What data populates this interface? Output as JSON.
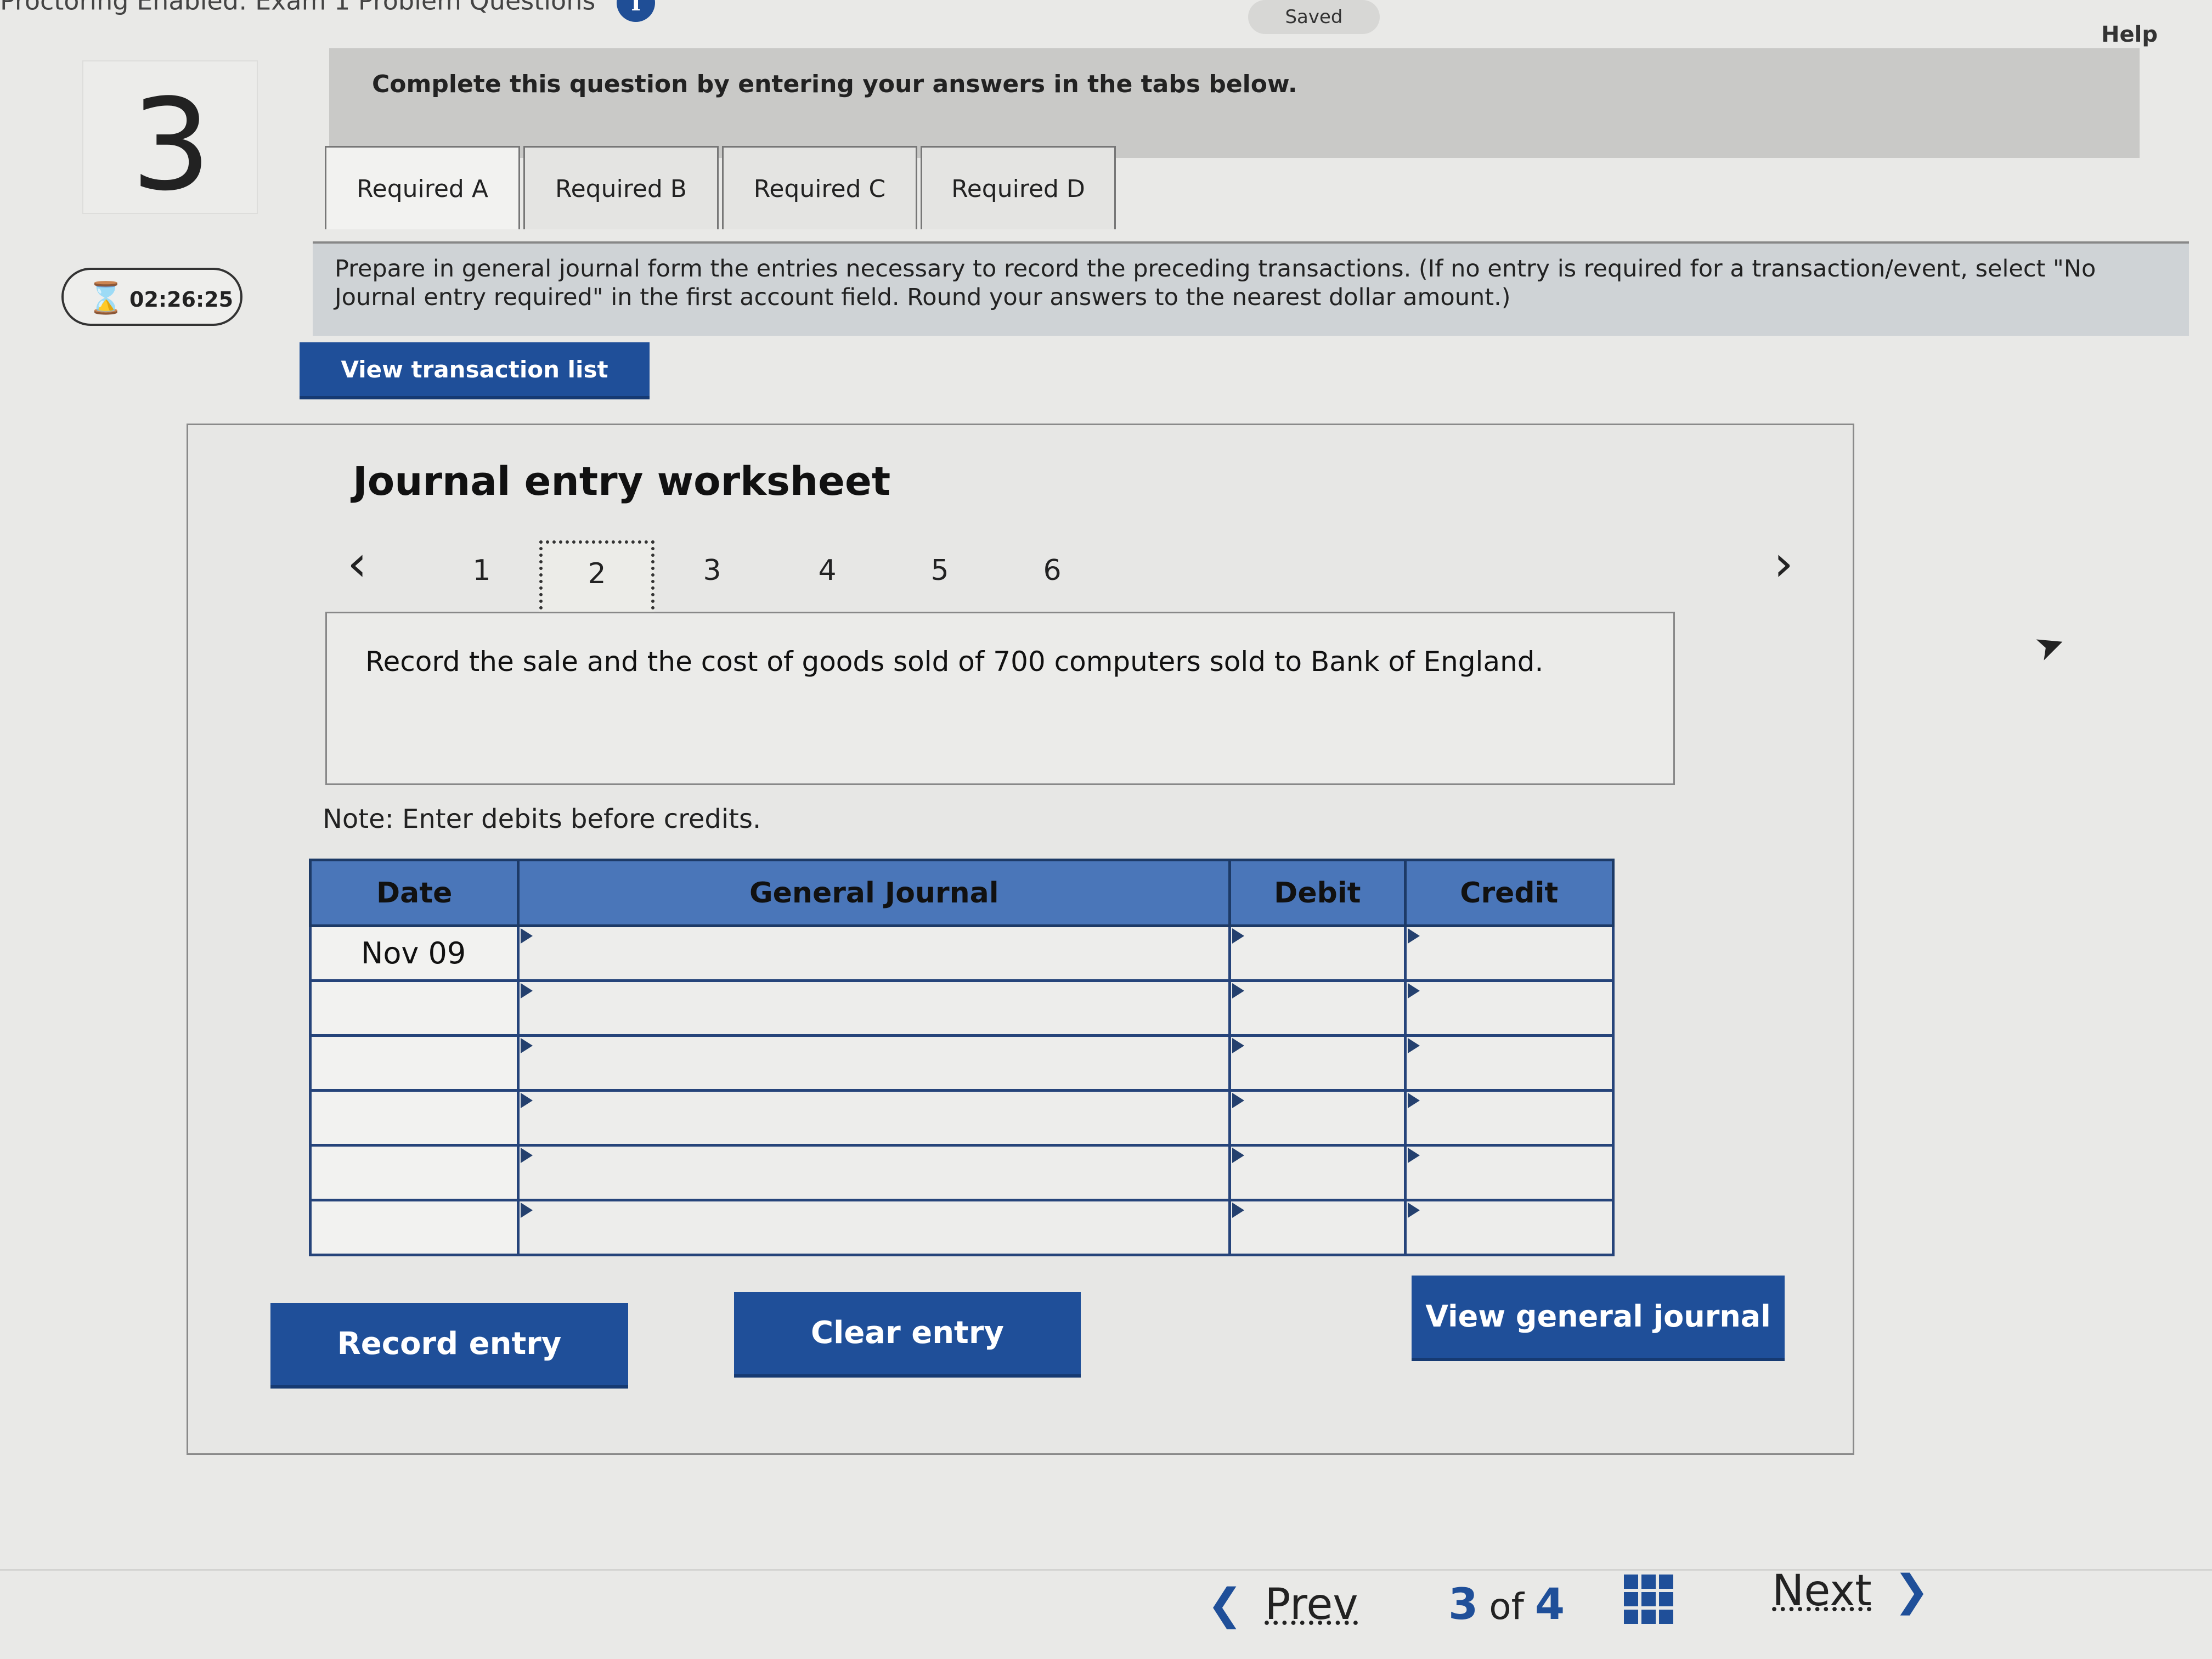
{
  "header": {
    "title": "Proctoring Enabled: Exam 1 Problem Questions",
    "saved_label": "Saved",
    "help_label": "Help"
  },
  "question": {
    "number": "3",
    "timer": "02:26:25"
  },
  "instruction": "Complete this question by entering your answers in the tabs below.",
  "tabs": [
    {
      "label": "Required A"
    },
    {
      "label": "Required B"
    },
    {
      "label": "Required C"
    },
    {
      "label": "Required D"
    }
  ],
  "prompt": "Prepare in general journal form the entries necessary to record the preceding transactions. (If no entry is required for a transaction/event, select \"No Journal entry required\" in the first account field. Round your answers to the nearest dollar amount.)",
  "buttons": {
    "view_transaction_list": "View transaction list",
    "record_entry": "Record entry",
    "clear_entry": "Clear entry",
    "view_general_journal": "View general journal"
  },
  "worksheet": {
    "title": "Journal entry worksheet",
    "pages": [
      "1",
      "2",
      "3",
      "4",
      "5",
      "6"
    ],
    "active_page": "2",
    "description": "Record the sale and the cost of goods sold of 700 computers sold to Bank of England.",
    "note": "Note: Enter debits before credits.",
    "columns": [
      "Date",
      "General Journal",
      "Debit",
      "Credit"
    ],
    "rows": [
      {
        "date": "Nov 09",
        "account": "",
        "debit": "",
        "credit": ""
      },
      {
        "date": "",
        "account": "",
        "debit": "",
        "credit": ""
      },
      {
        "date": "",
        "account": "",
        "debit": "",
        "credit": ""
      },
      {
        "date": "",
        "account": "",
        "debit": "",
        "credit": ""
      },
      {
        "date": "",
        "account": "",
        "debit": "",
        "credit": ""
      },
      {
        "date": "",
        "account": "",
        "debit": "",
        "credit": ""
      }
    ]
  },
  "footer": {
    "prev_label": "Prev",
    "current": "3",
    "of_label": "of",
    "total": "4",
    "next_label": "Next"
  },
  "colors": {
    "accent": "#1f4f99",
    "table_header": "#4a76b9"
  }
}
